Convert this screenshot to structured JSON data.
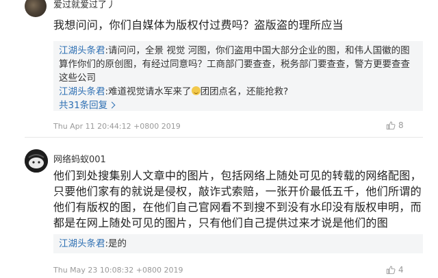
{
  "comments": [
    {
      "username": "爱过就爱过了丿",
      "text": "我想问问，你们自媒体为版权付过费吗？盗版盗的理所应当",
      "replies": [
        {
          "author": "江湖头条君",
          "text": ":请问问，全景 视觉 河图，你们盗用中国大部分企业的图，和伟人国徽的图算作你们的原创图，有经过同意吗？工商部门要查查，税务部门要查查，警方更要查查这些公司"
        },
        {
          "author": "江湖头条君",
          "text": ":难道视觉请水军来了",
          "text_after": "团团点名，还能抢救?"
        }
      ],
      "more_replies": "共31条回复",
      "timestamp": "Thu Apr 11 20:44:12 +0800 2019",
      "likes": "8"
    },
    {
      "username": "网络蚂蚁001",
      "text": "他们到处搜集别人文章中的图片，包括网络上随处可见的转载的网络配图，只要他们家有的就说是侵权，敲诈式索赔，一张开价最低五千，他们所谓的他们有版权的图，在他们自己官网看不到搜不到没有水印没有版权申明，而都是在网上随处可见的图片，只有他们自己提供过来才说是他们的图",
      "replies": [
        {
          "author": "江湖头条君",
          "text": ":是的"
        }
      ],
      "timestamp": "Thu May 23 10:08:32 +0800 2019",
      "likes": "4"
    }
  ],
  "icons": {
    "like": "thumbs-up-icon",
    "more": "chevron-right-icon",
    "emoji": "smile-emoji-icon"
  }
}
